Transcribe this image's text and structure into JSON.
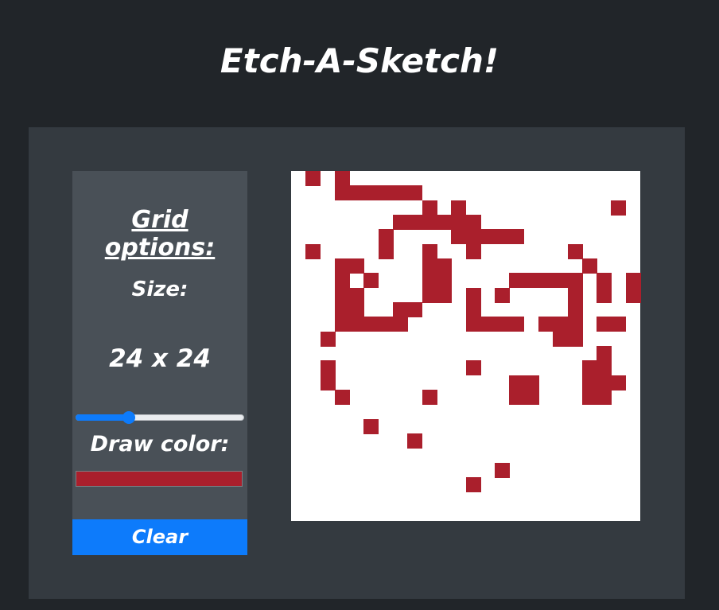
{
  "title": "Etch-A-Sketch!",
  "sidebar": {
    "heading": "Grid options:",
    "size_label": "Size:",
    "size_value": "24 x 24",
    "slider_value_fraction": 0.3,
    "color_label": "Draw color:",
    "clear_label": "Clear"
  },
  "colors": {
    "draw": "#aa1f2c",
    "accent": "#0d7bfb",
    "cell_empty": "#ffffff"
  },
  "grid": {
    "size": 24,
    "filled_rows": [
      "010100000000000000000000",
      "000111111000000000000000",
      "000000000101000000000010",
      "000000011111100000000000",
      "000000100001111100000000",
      "010000100100100000010000",
      "000110000110000000001000",
      "000101000110000111110101",
      "000110000110101000010101",
      "000110011000100000010000",
      "000111110000111101110110",
      "001000000000000000110000",
      "000000000000000000000100",
      "001000000000100000001100",
      "001000000000000110001110",
      "000100000100000110001100",
      "000000000000000000000000",
      "000001000000000000000000",
      "000000001000000000000000",
      "000000000000000000000000",
      "000000000000001000000000",
      "000000000000100000000000",
      "000000000000000000000000",
      "000000000000000000000000"
    ]
  }
}
